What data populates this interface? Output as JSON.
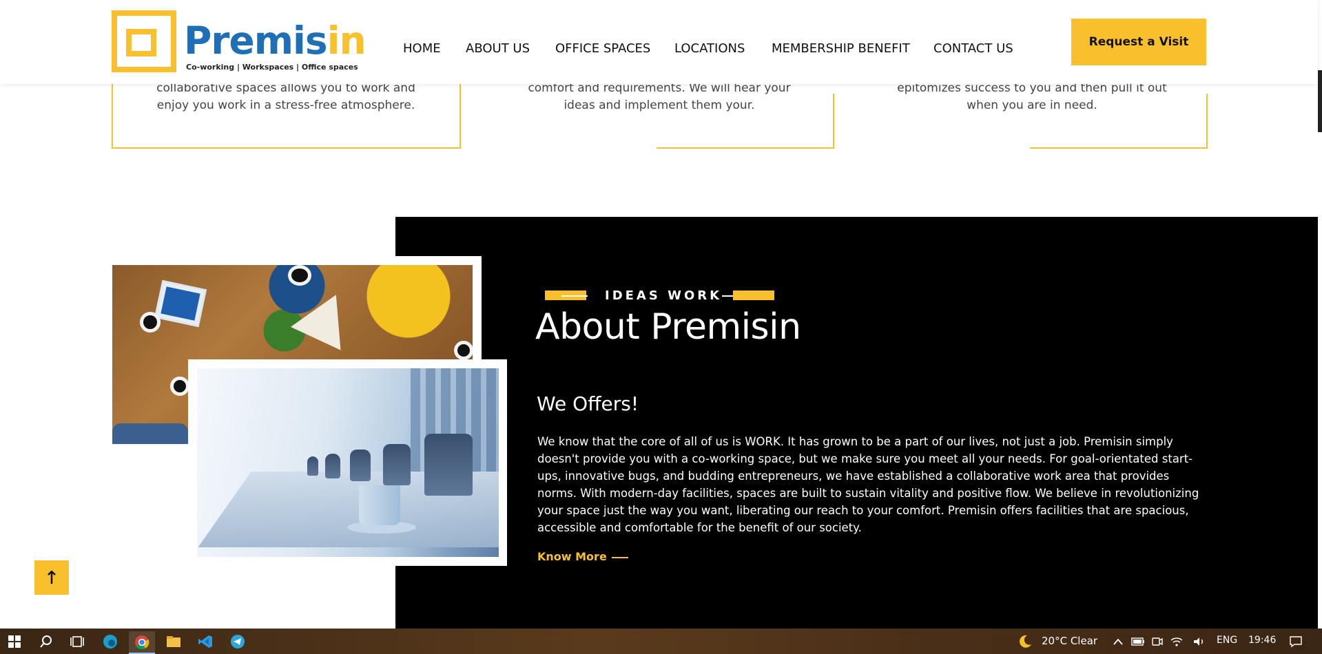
{
  "header": {
    "logo_main": "Premis",
    "logo_accent": "in",
    "logo_tagline": "Co-working | Workspaces | Office spaces",
    "nav": [
      "HOME",
      "ABOUT US",
      "OFFICE SPACES",
      "LOCATIONS",
      "MEMBERSHIP BENEFIT",
      "CONTACT US"
    ],
    "cta_label": "Request a Visit"
  },
  "features": [
    {
      "text": "collaborative spaces allows you to work and enjoy you work in a stress-free atmosphere."
    },
    {
      "text": "comfort and requirements. We will hear your ideas and implement them your."
    },
    {
      "text": "epitomizes success to you and then pull it out when you are in need."
    }
  ],
  "about": {
    "eyebrow": "IDEAS WORK",
    "title": "About Premisin",
    "subtitle": "We Offers!",
    "body": "We know that the core of all of us is WORK. It has grown to be a part of our lives, not just a job. Premisin simply doesn't provide you with a co-working space, but we make sure you meet all your needs. For goal-orientated start-ups, innovative bugs, and budding entrepreneurs, we have established a collaborative work area that provides norms. With modern-day facilities, spaces are built to sustain vitality and positive flow. We believe in revolutionizing your space just the way you want, liberating our reach to your comfort. Premisin offers facilities that are spacious, accessible and comfortable for the benefit of our society.",
    "link": "Know More"
  },
  "taskbar": {
    "weather": "20°C  Clear",
    "language": "ENG",
    "time": "19:46"
  },
  "colors": {
    "accent": "#f9c02e",
    "brand_blue": "#1f6fb6",
    "dark_section": "#000000"
  },
  "icons": [
    "windows-start-icon",
    "search-icon",
    "task-view-icon",
    "edge-icon",
    "chrome-icon",
    "file-explorer-icon",
    "vscode-icon",
    "telegram-icon",
    "moon-icon",
    "chevron-up-icon",
    "battery-icon",
    "meet-now-icon",
    "wifi-icon",
    "volume-icon",
    "notification-icon",
    "arrow-up-icon"
  ]
}
